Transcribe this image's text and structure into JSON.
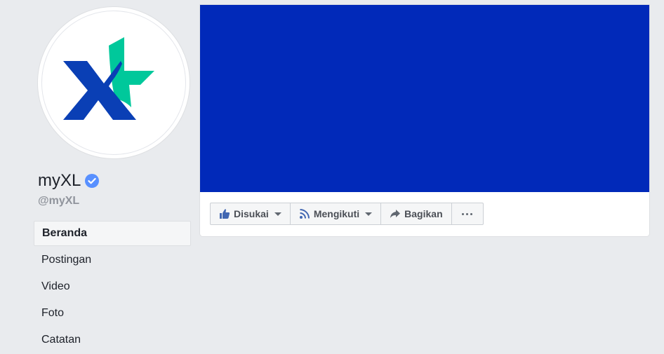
{
  "profile": {
    "name": "myXL",
    "handle": "@myXL",
    "verified": true,
    "logo_colors": {
      "navy": "#0a3fb5",
      "teal": "#00c89b"
    }
  },
  "nav": {
    "items": [
      {
        "label": "Beranda",
        "active": true
      },
      {
        "label": "Postingan",
        "active": false
      },
      {
        "label": "Video",
        "active": false
      },
      {
        "label": "Foto",
        "active": false
      },
      {
        "label": "Catatan",
        "active": false
      }
    ]
  },
  "cover": {
    "color": "#0129b9"
  },
  "actions": {
    "like_label": "Disukai",
    "follow_label": "Mengikuti",
    "share_label": "Bagikan",
    "more_icon": "ellipsis-icon"
  },
  "colors": {
    "background": "#e9ebee",
    "accent": "#4267b2",
    "verified": "#5890ff"
  }
}
